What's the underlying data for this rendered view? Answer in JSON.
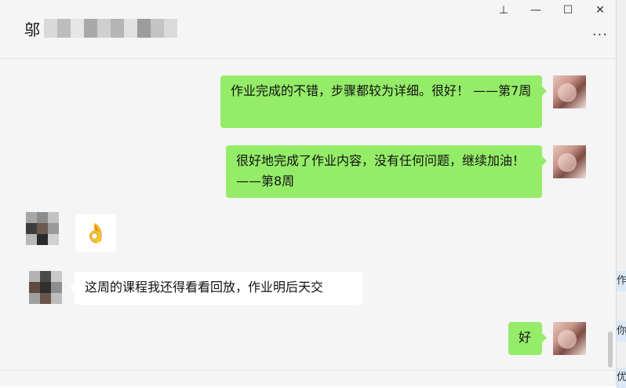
{
  "window": {
    "title_visible": "邬",
    "controls": {
      "pin": "⊥",
      "minimize": "—",
      "maximize": "☐",
      "close": "✕"
    },
    "more": "···"
  },
  "messages": [
    {
      "from": "me",
      "text": "作业完成的不错，步骤都较为详细。很好！ ——第7周"
    },
    {
      "from": "me",
      "text": "很好地完成了作业内容，没有任何问题，继续加油！ ——第8周"
    },
    {
      "from": "them",
      "type": "emoji",
      "emoji": "👌"
    },
    {
      "from": "them",
      "text": "这周的课程我还得看看回放，作业明后天交"
    },
    {
      "from": "me",
      "text": "好"
    }
  ],
  "background_window_fragments": [
    "作",
    "你",
    "优"
  ],
  "colors": {
    "my_bubble": "#95ec69",
    "their_bubble": "#ffffff",
    "chat_bg": "#f5f5f5"
  }
}
